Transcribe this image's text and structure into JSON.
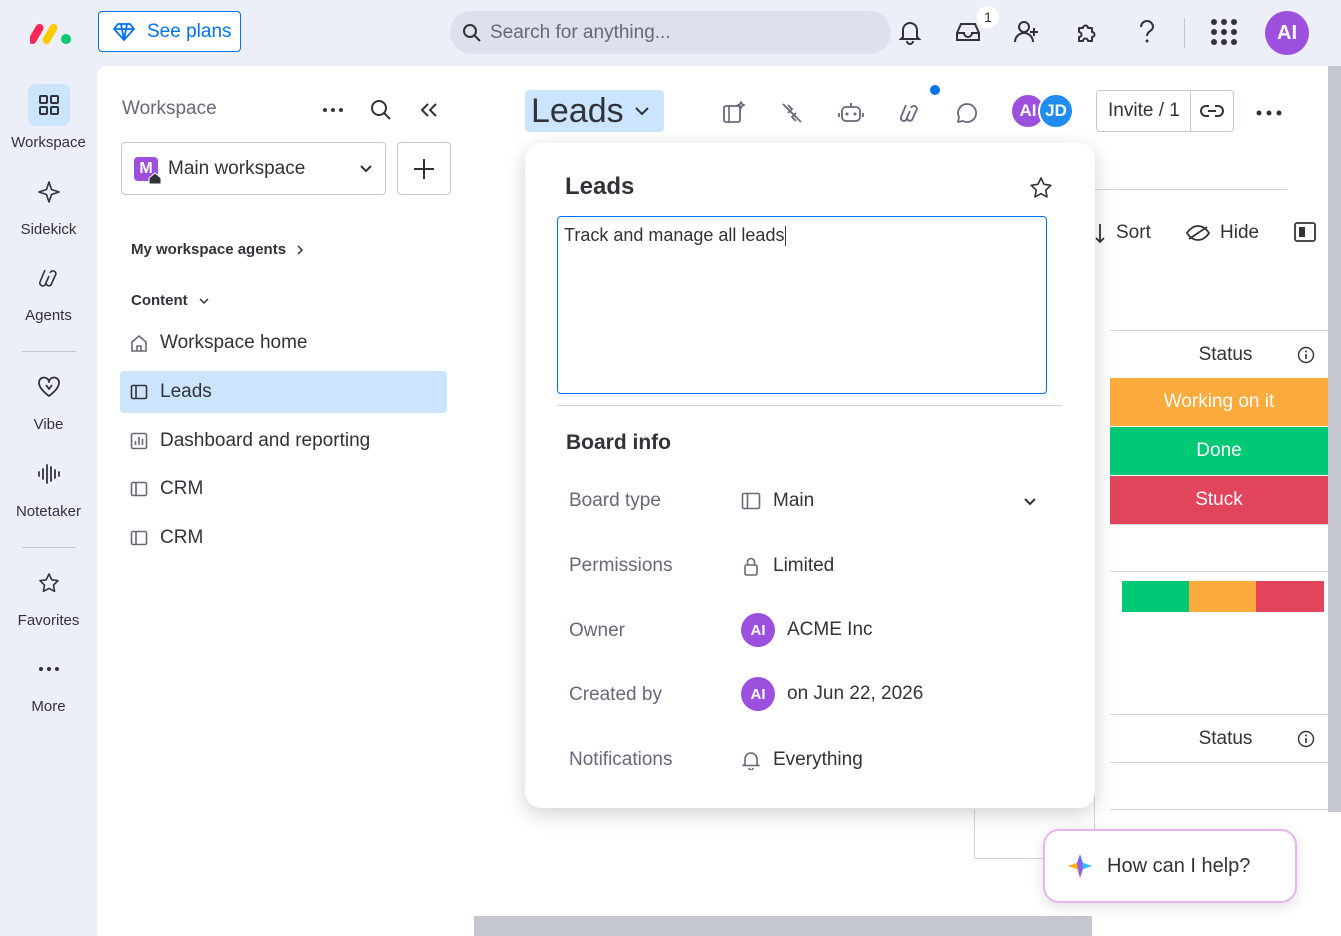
{
  "topbar": {
    "see_plans": "See plans",
    "search_placeholder": "Search for anything...",
    "inbox_badge": "1",
    "avatar": "AI"
  },
  "rail": {
    "items": [
      {
        "label": "Workspace",
        "icon": "grid-icon",
        "active": true
      },
      {
        "label": "Sidekick",
        "icon": "sparkle-icon"
      },
      {
        "label": "Agents",
        "icon": "agents-icon"
      },
      {
        "label": "Vibe",
        "icon": "heart-icon"
      },
      {
        "label": "Notetaker",
        "icon": "waveform-icon"
      },
      {
        "label": "Favorites",
        "icon": "star-icon"
      },
      {
        "label": "More",
        "icon": "dots-icon"
      }
    ]
  },
  "workspace": {
    "header": "Workspace",
    "selected": "Main workspace",
    "selected_initial": "M",
    "agents_section": "My workspace agents",
    "content_section": "Content",
    "items": [
      {
        "label": "Workspace home",
        "icon": "home-icon"
      },
      {
        "label": "Leads",
        "icon": "board-icon",
        "active": true
      },
      {
        "label": "Dashboard and reporting",
        "icon": "dashboard-icon"
      },
      {
        "label": "CRM",
        "icon": "board-icon"
      },
      {
        "label": "CRM",
        "icon": "board-icon"
      }
    ]
  },
  "main": {
    "board_title": "Leads",
    "avatars": [
      "AI",
      "JD"
    ],
    "invite": "Invite / 1",
    "sort": "Sort",
    "hide": "Hide",
    "status_header": "Status",
    "statuses": [
      {
        "label": "Working on it",
        "color": "#fdab3d"
      },
      {
        "label": "Done",
        "color": "#00c875"
      },
      {
        "label": "Stuck",
        "color": "#e2445c"
      }
    ],
    "status_header_2": "Status"
  },
  "popover": {
    "title": "Leads",
    "description": "Track and manage all leads",
    "board_info": "Board info",
    "rows": {
      "board_type": {
        "label": "Board type",
        "value": "Main"
      },
      "permissions": {
        "label": "Permissions",
        "value": "Limited"
      },
      "owner": {
        "label": "Owner",
        "value": "ACME Inc",
        "avatar": "AI"
      },
      "created_by": {
        "label": "Created by",
        "value": "on Jun 22, 2026",
        "avatar": "AI"
      },
      "notifications": {
        "label": "Notifications",
        "value": "Everything"
      }
    }
  },
  "help": {
    "label": "How can I help?"
  },
  "colors": {
    "accent": "#0073ea",
    "purple": "#9d50dd",
    "done": "#00c875",
    "working": "#fdab3d",
    "stuck": "#e2445c"
  }
}
